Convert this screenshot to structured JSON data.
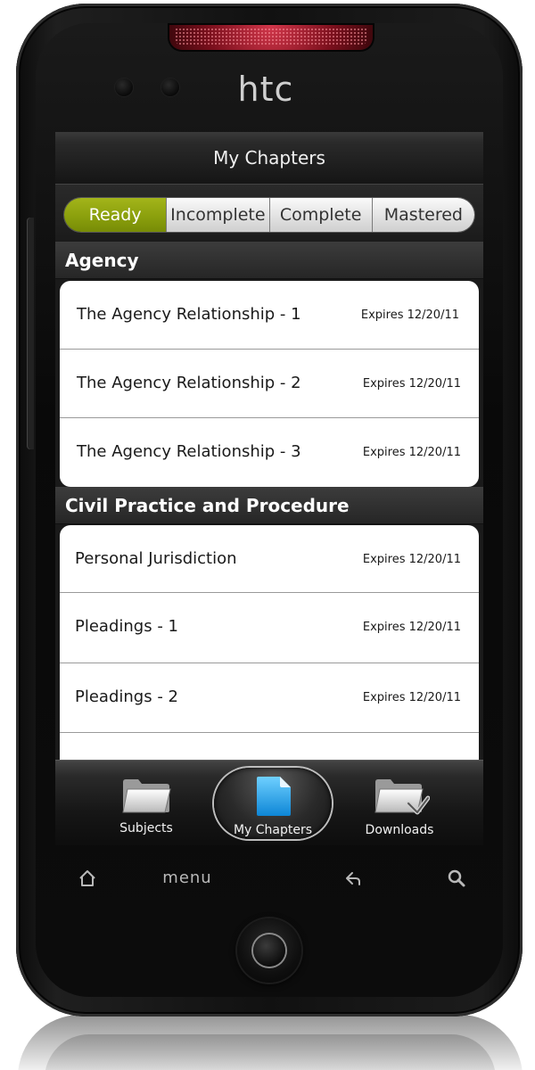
{
  "device": {
    "brand": "htc"
  },
  "app": {
    "title": "My Chapters"
  },
  "tabs": [
    {
      "label": "Ready",
      "active": true
    },
    {
      "label": "Incomplete",
      "active": false
    },
    {
      "label": "Complete",
      "active": false
    },
    {
      "label": "Mastered",
      "active": false
    }
  ],
  "sections": [
    {
      "header": "Agency",
      "items": [
        {
          "title": "The Agency Relationship - 1",
          "expires": "Expires 12/20/11"
        },
        {
          "title": "The Agency Relationship - 2",
          "expires": "Expires 12/20/11"
        },
        {
          "title": "The Agency Relationship - 3",
          "expires": "Expires 12/20/11"
        }
      ]
    },
    {
      "header": "Civil Practice and Procedure",
      "items": [
        {
          "title": "Personal Jurisdiction",
          "expires": "Expires 12/20/11"
        },
        {
          "title": "Pleadings - 1",
          "expires": "Expires 12/20/11"
        },
        {
          "title": "Pleadings - 2",
          "expires": "Expires 12/20/11"
        }
      ]
    }
  ],
  "bottom_nav": [
    {
      "label": "Subjects",
      "icon": "folder-icon",
      "active": false
    },
    {
      "label": "My Chapters",
      "icon": "document-icon",
      "active": true
    },
    {
      "label": "Downloads",
      "icon": "folder-download-icon",
      "active": false
    }
  ],
  "hardware_buttons": {
    "home_icon": "home-icon",
    "menu_label": "menu",
    "back_icon": "back-arrow-icon",
    "search_icon": "search-icon"
  },
  "colors": {
    "active_tab": "#8ba00d",
    "active_doc_icon": "#1fa3ea",
    "speaker": "#b01d31"
  }
}
